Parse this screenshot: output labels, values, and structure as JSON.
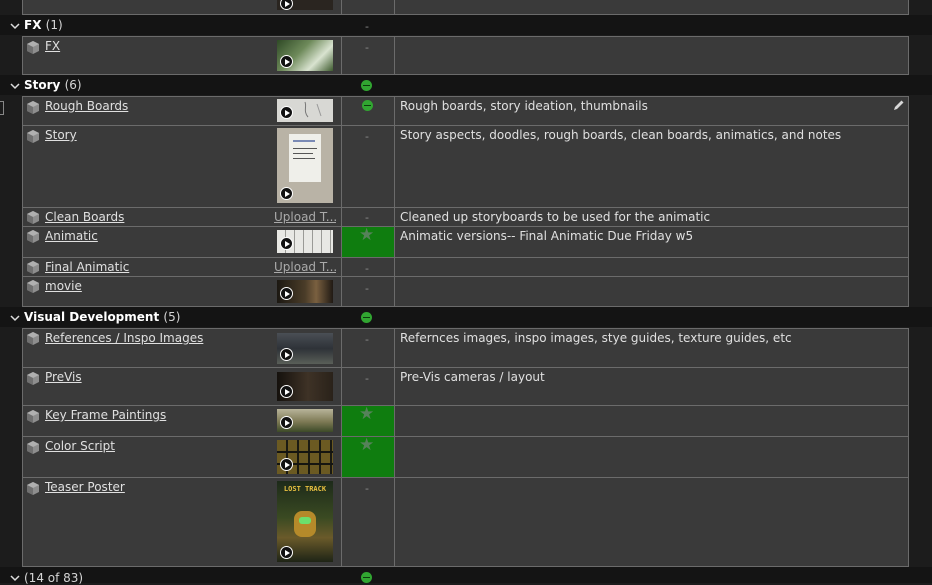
{
  "colors": {
    "status_green": "#31a531",
    "cell_green": "#0f7d0f",
    "row_bg": "#3a3a3a",
    "group_bg": "#141414"
  },
  "groups": {
    "fx": {
      "label": "FX",
      "count": "(1)",
      "status": "-"
    },
    "story": {
      "label": "Story",
      "count": "(6)"
    },
    "visdev": {
      "label": "Visual Development",
      "count": "(5)"
    },
    "bottom": {
      "count": "(14 of 83)"
    }
  },
  "rows": {
    "fx": {
      "name": "FX",
      "status": "-",
      "desc": ""
    },
    "rough_boards": {
      "name": "Rough Boards",
      "desc": "Rough boards, story ideation, thumbnails"
    },
    "story": {
      "name": "Story",
      "status": "-",
      "desc": "Story aspects, doodles, rough boards, clean boards, animatics, and notes"
    },
    "clean_boards": {
      "name": "Clean Boards",
      "upload": "Upload T...",
      "status": "-",
      "desc": "Cleaned up storyboards to be used for the animatic"
    },
    "animatic": {
      "name": "Animatic",
      "desc": "Animatic versions-- Final Animatic Due Friday w5"
    },
    "final_animatic": {
      "name": "Final Animatic",
      "upload": "Upload T...",
      "status": "-",
      "desc": ""
    },
    "movie": {
      "name": "movie",
      "status": "-",
      "desc": ""
    },
    "references": {
      "name": "References / Inspo Images",
      "status": "-",
      "desc": "Refernces images, inspo images, stye guides, texture guides, etc"
    },
    "previs": {
      "name": "PreVis",
      "status": "-",
      "desc": "Pre-Vis cameras / layout"
    },
    "keyframe": {
      "name": "Key Frame Paintings",
      "desc": ""
    },
    "colorscript": {
      "name": "Color Script",
      "desc": ""
    },
    "teaser": {
      "name": "Teaser Poster",
      "status": "-",
      "desc": "",
      "poster_text": "LOST TRACK"
    }
  },
  "icons": {
    "entity": "cube-icon",
    "expand": "chevron-down-icon",
    "edit": "pencil-icon",
    "play": "play-icon",
    "star": "star-icon"
  }
}
